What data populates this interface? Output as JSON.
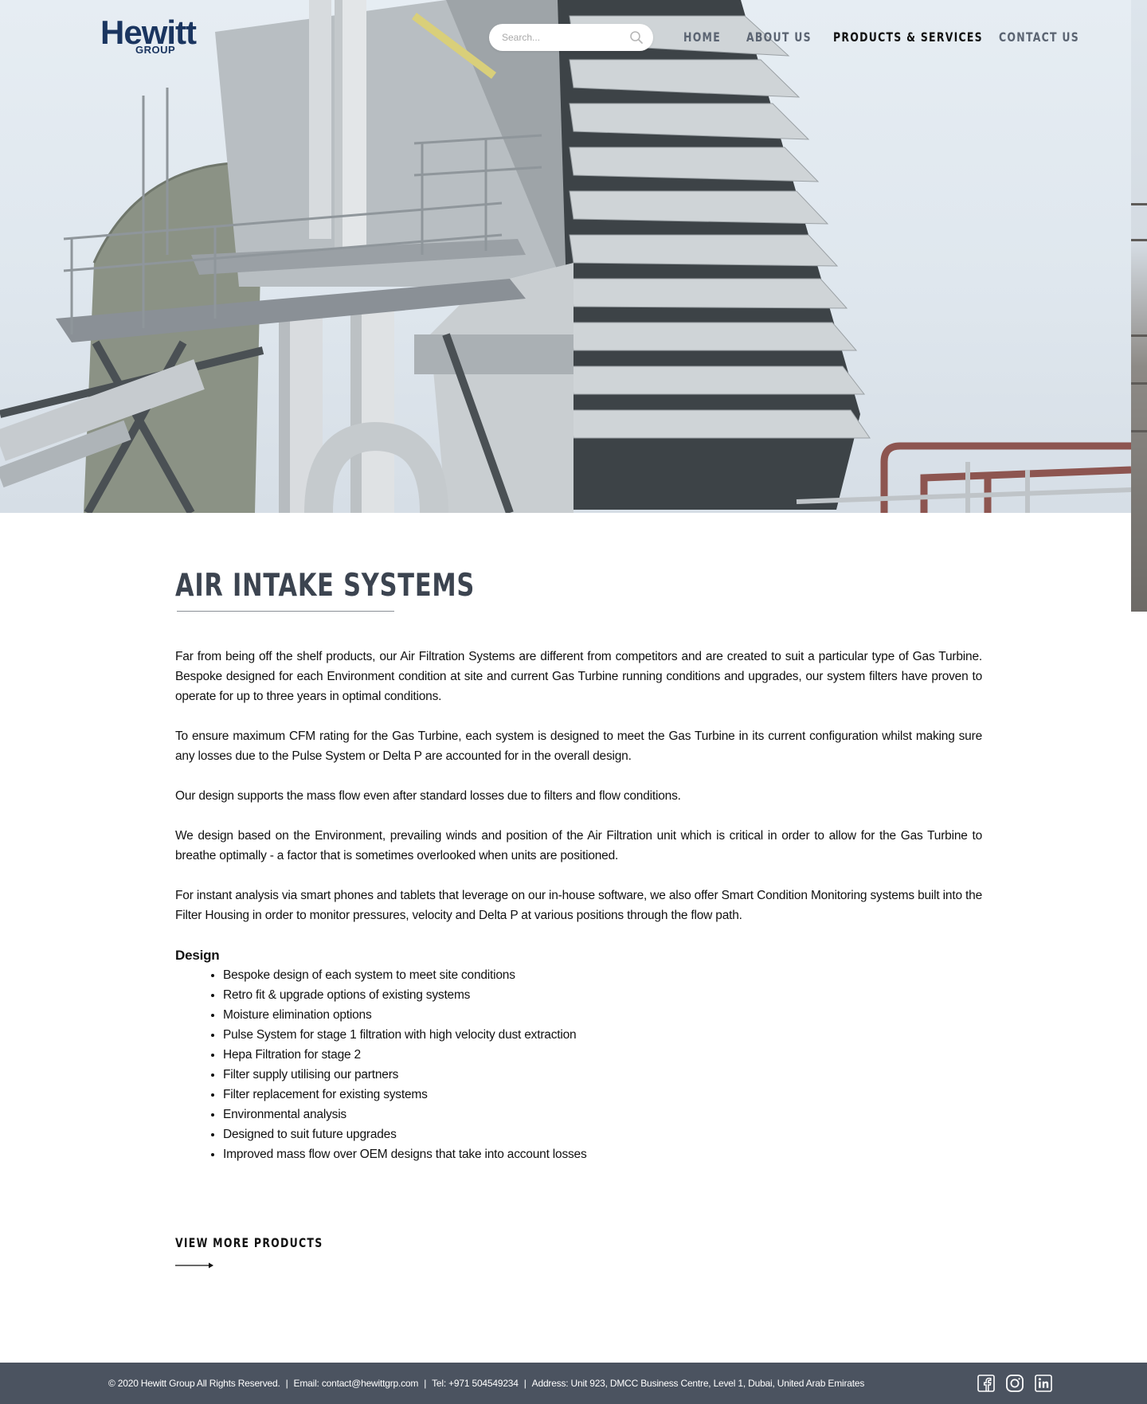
{
  "header": {
    "logo_main": "Hewitt",
    "logo_sub": "GROUP",
    "search_placeholder": "Search...",
    "nav": {
      "home": "HOME",
      "about": "ABOUT US",
      "products": "PRODUCTS & SERVICES",
      "contact": "CONTACT US"
    },
    "active_nav": "products"
  },
  "main": {
    "title": "AIR INTAKE SYSTEMS",
    "paragraphs": [
      "Far from being off the shelf products, our Air Filtration Systems are different from competitors and are created to suit a particular type of Gas Turbine. Bespoke designed for each Environment condition at site and current Gas Turbine running conditions and upgrades, our system filters have proven to operate for up to three years in optimal conditions.",
      "To ensure maximum CFM rating for the Gas Turbine, each system is designed to meet the Gas Turbine in its current configuration whilst making sure any losses due to the Pulse System or Delta P are accounted for in the overall design.",
      "Our design supports the mass flow even after standard losses due to filters and flow conditions.",
      "We design based on the Environment, prevailing winds and position of the Air Filtration unit which is critical in order to allow for the Gas Turbine to breathe optimally - a factor that is sometimes overlooked when units are positioned.",
      "For instant analysis via smart phones and tablets that leverage on our in-house software, we also offer Smart Condition Monitoring systems built into the Filter Housing in order to monitor pressures, velocity and Delta P at various positions through the flow path."
    ],
    "design_heading": "Design",
    "design_items": [
      "Bespoke design of each system to meet site conditions",
      "Retro fit & upgrade options of existing systems",
      "Moisture elimination options",
      "Pulse System for stage 1 filtration with high velocity dust extraction",
      "Hepa Filtration for stage 2",
      "Filter supply utilising our partners",
      "Filter replacement for existing systems",
      "Environmental analysis",
      "Designed to suit future upgrades",
      "Improved mass flow over OEM designs that take into account losses"
    ],
    "view_more": "VIEW MORE PRODUCTS"
  },
  "footer": {
    "copyright": "© 2020 Hewitt Group All Rights Reserved.",
    "email": "Email: contact@hewittgrp.com",
    "tel": "Tel: +971 504549234",
    "address": "Address: Unit 923, DMCC Business Centre, Level 1, Dubai, United Arab Emirates",
    "separator": "|",
    "social": [
      "facebook-icon",
      "instagram-icon",
      "linkedin-icon"
    ]
  },
  "colors": {
    "brand_navy": "#1a3560",
    "title_gray": "#3c4450",
    "nav_gray": "#5b6472",
    "footer_bg": "#4b5360"
  }
}
